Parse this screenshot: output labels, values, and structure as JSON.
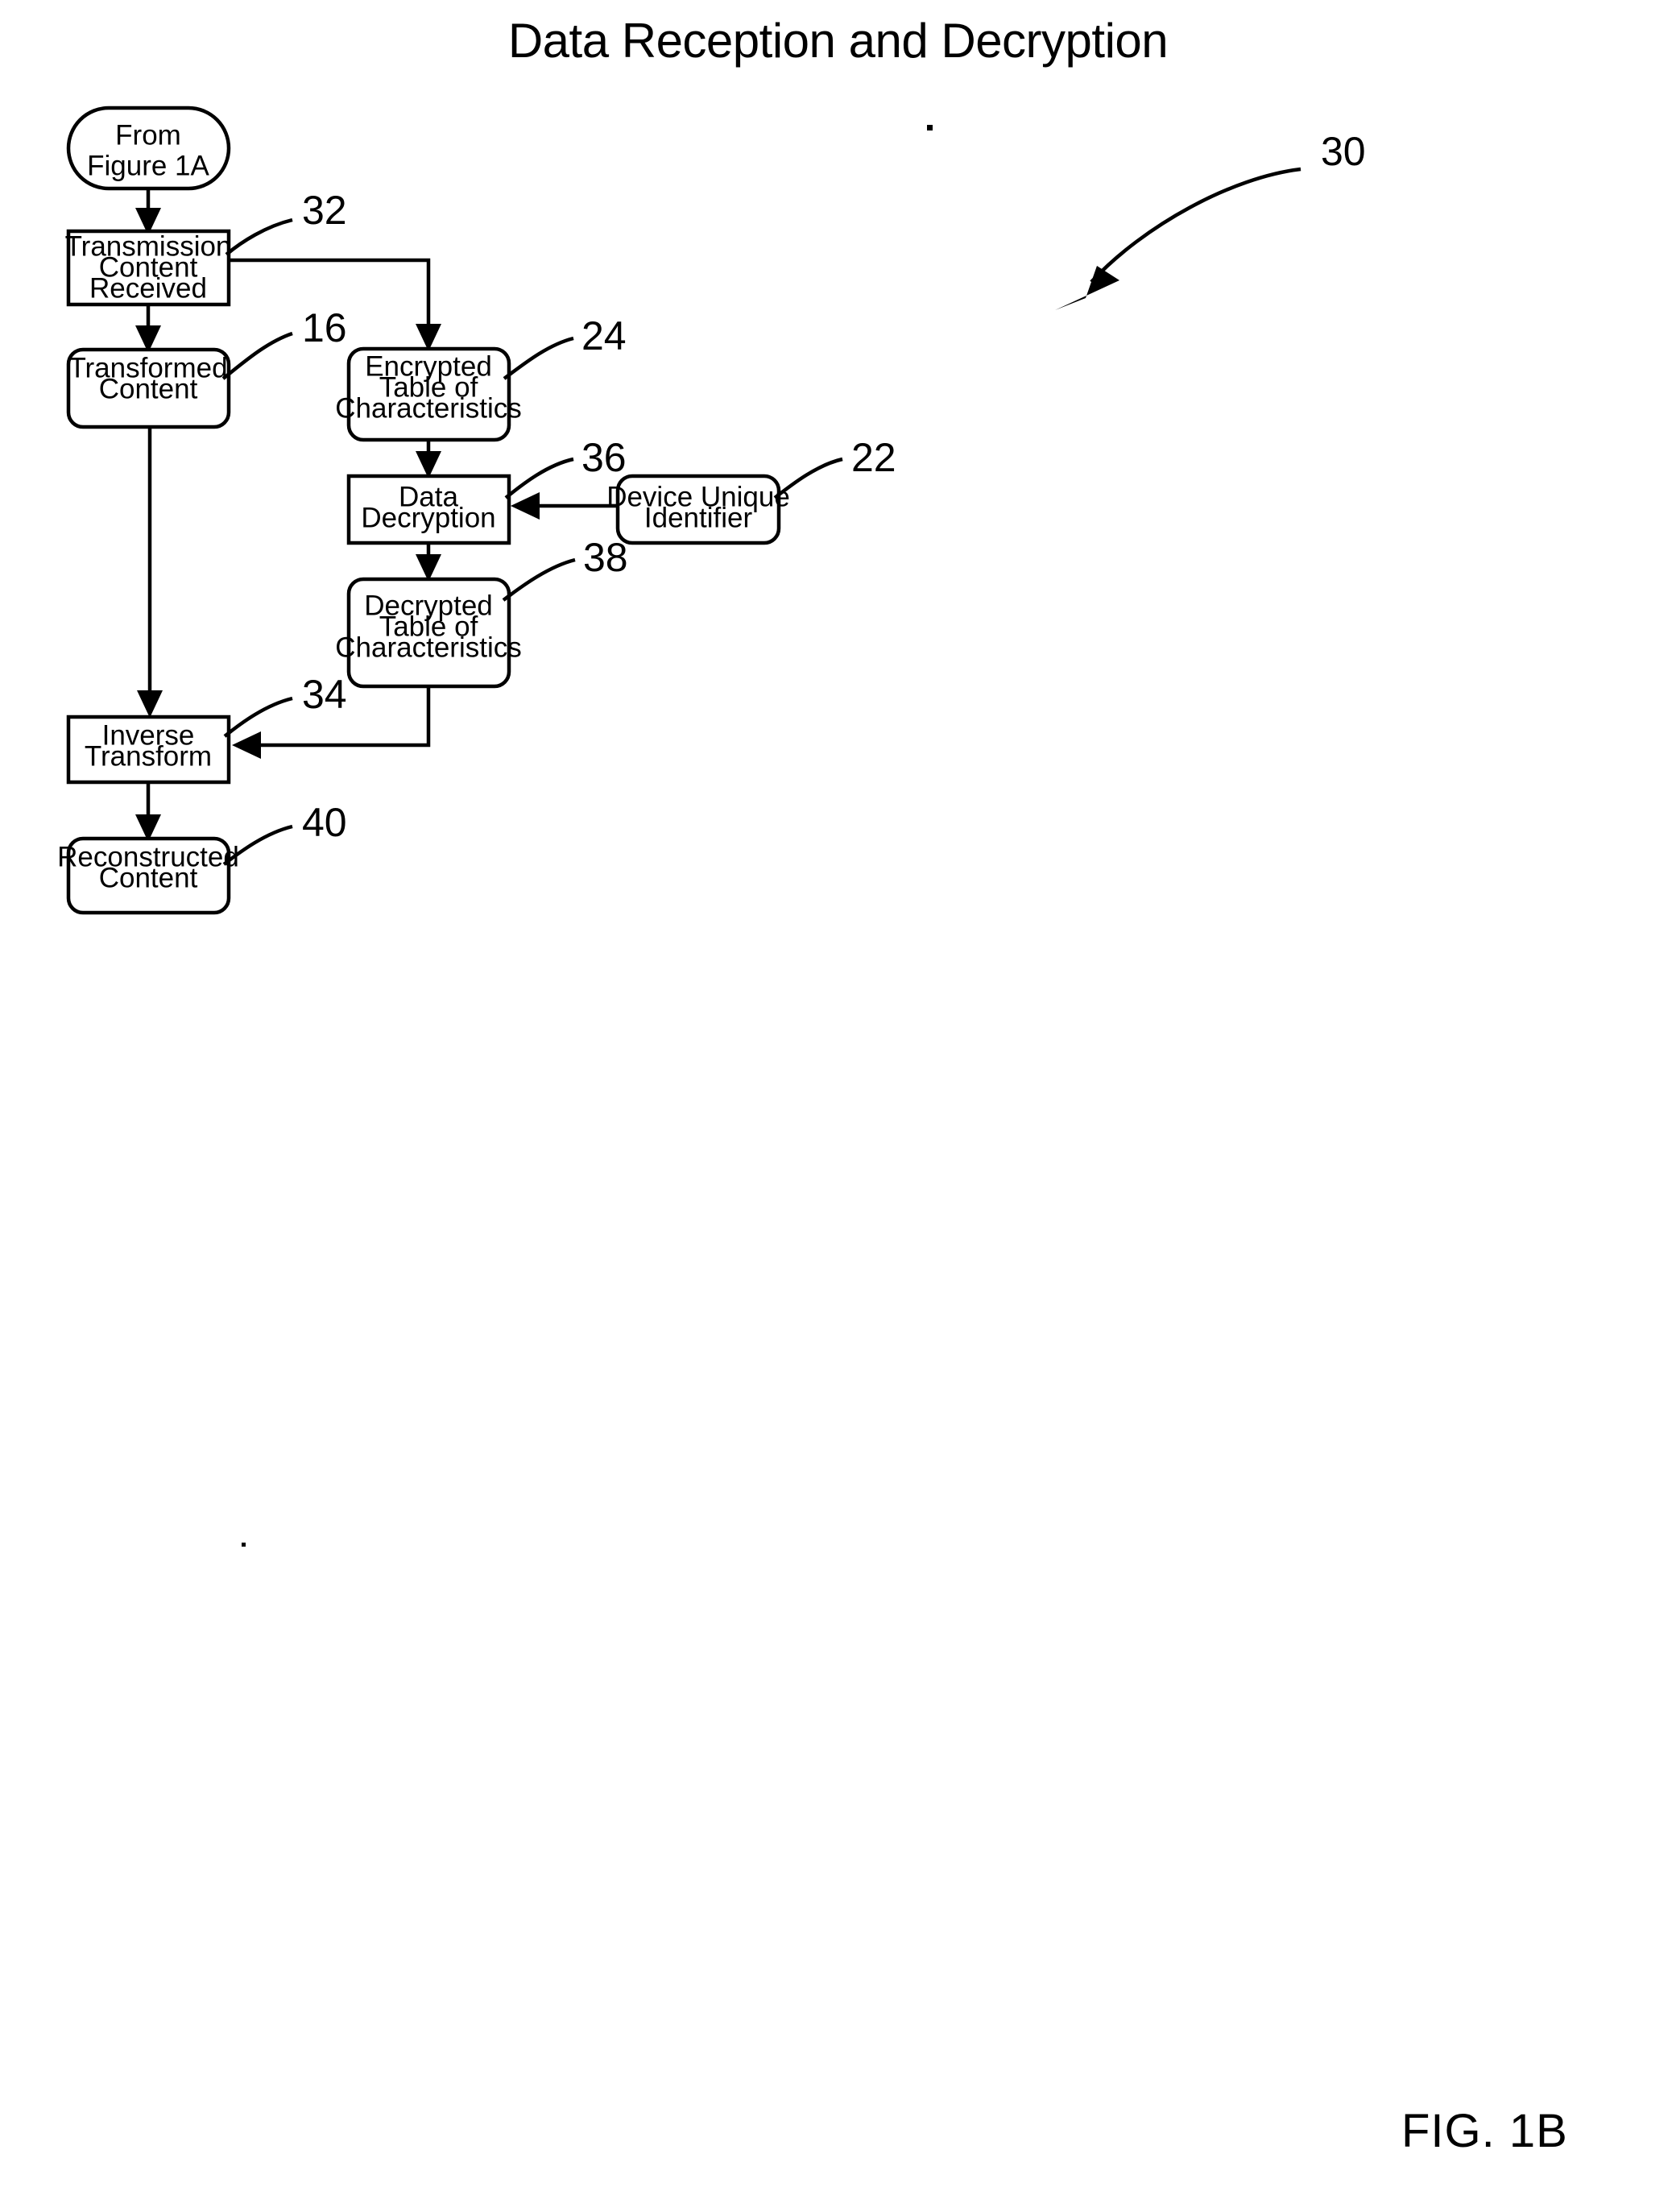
{
  "title": "Data Reception and Decryption",
  "figure_caption": "FIG. 1B",
  "diagram": {
    "type": "flowchart",
    "overall_reference": "30",
    "nodes": [
      {
        "id": "from_fig_1a",
        "label_lines": [
          "From",
          "Figure 1A"
        ],
        "shape": "stadium",
        "reference": ""
      },
      {
        "id": "transmission_content_received",
        "label_lines": [
          "Transmission",
          "Content",
          "Received"
        ],
        "shape": "rect",
        "reference": "32"
      },
      {
        "id": "transformed_content",
        "label_lines": [
          "Transformed",
          "Content"
        ],
        "shape": "rounded",
        "reference": "16"
      },
      {
        "id": "encrypted_table",
        "label_lines": [
          "Encrypted",
          "Table of",
          "Characteristics"
        ],
        "shape": "rounded",
        "reference": "24"
      },
      {
        "id": "data_decryption",
        "label_lines": [
          "Data",
          "Decryption"
        ],
        "shape": "rect",
        "reference": "36"
      },
      {
        "id": "device_unique_identifier",
        "label_lines": [
          "Device Unique",
          "Identifier"
        ],
        "shape": "rounded",
        "reference": "22"
      },
      {
        "id": "decrypted_table",
        "label_lines": [
          "Decrypted",
          "Table of",
          "Characteristics"
        ],
        "shape": "rounded",
        "reference": "38"
      },
      {
        "id": "inverse_transform",
        "label_lines": [
          "Inverse",
          "Transform"
        ],
        "shape": "rect",
        "reference": "34"
      },
      {
        "id": "reconstructed_content",
        "label_lines": [
          "Reconstructed",
          "Content"
        ],
        "shape": "rounded",
        "reference": "40"
      }
    ],
    "edges": [
      {
        "from": "from_fig_1a",
        "to": "transmission_content_received"
      },
      {
        "from": "transmission_content_received",
        "to": "transformed_content"
      },
      {
        "from": "transmission_content_received",
        "to": "encrypted_table"
      },
      {
        "from": "transformed_content",
        "to": "inverse_transform"
      },
      {
        "from": "encrypted_table",
        "to": "data_decryption"
      },
      {
        "from": "device_unique_identifier",
        "to": "data_decryption"
      },
      {
        "from": "data_decryption",
        "to": "decrypted_table"
      },
      {
        "from": "decrypted_table",
        "to": "inverse_transform"
      },
      {
        "from": "inverse_transform",
        "to": "reconstructed_content"
      }
    ]
  },
  "labels": {
    "n1_l1": "From",
    "n1_l2": "Figure 1A",
    "n2_l1": "Transmission",
    "n2_l2": "Content",
    "n2_l3": "Received",
    "n3_l1": "Transformed",
    "n3_l2": "Content",
    "n4_l1": "Encrypted",
    "n4_l2": "Table of",
    "n4_l3": "Characteristics",
    "n5_l1": "Data",
    "n5_l2": "Decryption",
    "n6_l1": "Device Unique",
    "n6_l2": "Identifier",
    "n7_l1": "Decrypted",
    "n7_l2": "Table of",
    "n7_l3": "Characteristics",
    "n8_l1": "Inverse",
    "n8_l2": "Transform",
    "n9_l1": "Reconstructed",
    "n9_l2": "Content"
  },
  "references": {
    "r30": "30",
    "r32": "32",
    "r16": "16",
    "r24": "24",
    "r36": "36",
    "r22": "22",
    "r38": "38",
    "r34": "34",
    "r40": "40"
  },
  "colors": {
    "ink": "#000000",
    "paper": "#ffffff"
  }
}
